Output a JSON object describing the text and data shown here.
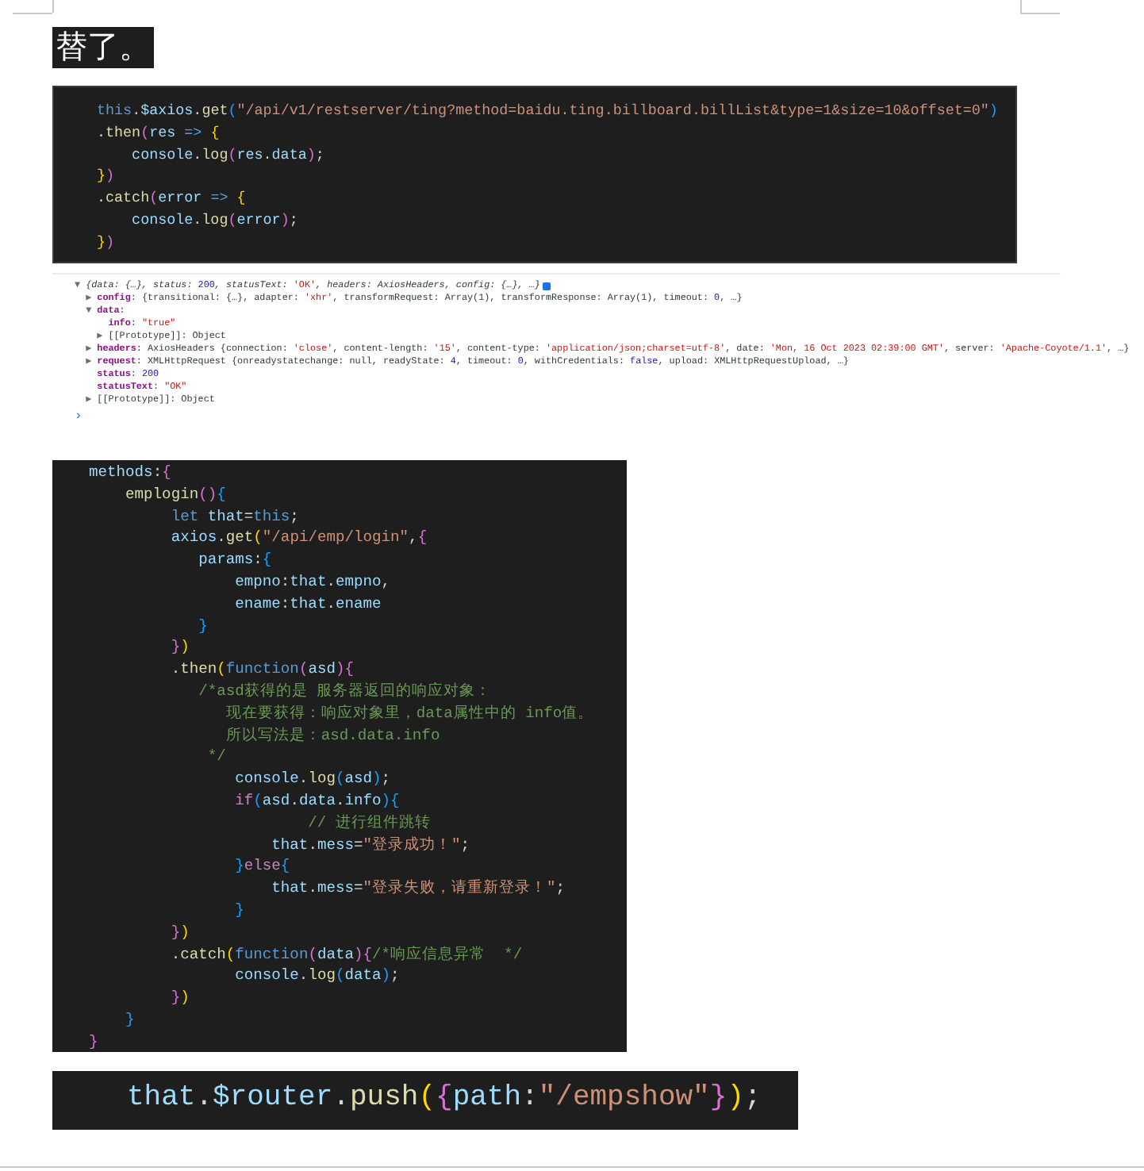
{
  "heading": "替了。",
  "code_block_1": [
    [
      {
        "text": "this",
        "kind": "kw"
      },
      {
        "text": ".",
        "kind": "p"
      },
      {
        "text": "$axios",
        "kind": "var"
      },
      {
        "text": ".",
        "kind": "p"
      },
      {
        "text": "get",
        "kind": "fn"
      },
      {
        "text": "(",
        "kind": "b3"
      },
      {
        "text": "\"/api/v1/restserver/ting?method=baidu.ting.billboard.billList&type=1&size=10&offset=0\"",
        "kind": "str"
      },
      {
        "text": ")",
        "kind": "b3"
      }
    ],
    [
      {
        "text": ".",
        "kind": "p"
      },
      {
        "text": "then",
        "kind": "fn"
      },
      {
        "text": "(",
        "kind": "b2"
      },
      {
        "text": "res",
        "kind": "var"
      },
      {
        "text": " => ",
        "kind": "kw"
      },
      {
        "text": "{",
        "kind": "b1"
      }
    ],
    [
      {
        "text": "    console",
        "kind": "var"
      },
      {
        "text": ".",
        "kind": "p"
      },
      {
        "text": "log",
        "kind": "fn"
      },
      {
        "text": "(",
        "kind": "b2"
      },
      {
        "text": "res",
        "kind": "var"
      },
      {
        "text": ".",
        "kind": "p"
      },
      {
        "text": "data",
        "kind": "var"
      },
      {
        "text": ")",
        "kind": "b2"
      },
      {
        "text": ";",
        "kind": "p"
      }
    ],
    [
      {
        "text": "}",
        "kind": "b1"
      },
      {
        "text": ")",
        "kind": "b2"
      }
    ],
    [
      {
        "text": ".",
        "kind": "p"
      },
      {
        "text": "catch",
        "kind": "fn"
      },
      {
        "text": "(",
        "kind": "b2"
      },
      {
        "text": "error",
        "kind": "var"
      },
      {
        "text": " => ",
        "kind": "kw"
      },
      {
        "text": "{",
        "kind": "b1"
      }
    ],
    [
      {
        "text": "    console",
        "kind": "var"
      },
      {
        "text": ".",
        "kind": "p"
      },
      {
        "text": "log",
        "kind": "fn"
      },
      {
        "text": "(",
        "kind": "b2"
      },
      {
        "text": "error",
        "kind": "var"
      },
      {
        "text": ")",
        "kind": "b2"
      },
      {
        "text": ";",
        "kind": "p"
      }
    ],
    [
      {
        "text": "}",
        "kind": "b1"
      },
      {
        "text": ")",
        "kind": "b2"
      }
    ]
  ],
  "console": [
    [
      {
        "text": "▼ ",
        "kind": "tri"
      },
      {
        "text": "{data: {…}, status: ",
        "kind": "it"
      },
      {
        "text": "200",
        "kind": "num"
      },
      {
        "text": ", statusText: ",
        "kind": "it"
      },
      {
        "text": "'OK'",
        "kind": "str"
      },
      {
        "text": ", headers: AxiosHeaders, config: {…}, …}",
        "kind": "it"
      }
    ],
    [
      {
        "text": "  ▶ ",
        "kind": "tri"
      },
      {
        "text": "config",
        "kind": "key"
      },
      {
        "text": ": {transitional: {…}, adapter: ",
        "kind": "p"
      },
      {
        "text": "'xhr'",
        "kind": "str"
      },
      {
        "text": ", transformRequest: Array(1), transformResponse: Array(1), timeout: ",
        "kind": "p"
      },
      {
        "text": "0",
        "kind": "num"
      },
      {
        "text": ", …}",
        "kind": "p"
      }
    ],
    [
      {
        "text": "  ▼ ",
        "kind": "tri"
      },
      {
        "text": "data",
        "kind": "key"
      },
      {
        "text": ":",
        "kind": "p"
      }
    ],
    [
      {
        "text": "      info",
        "kind": "key"
      },
      {
        "text": ": ",
        "kind": "p"
      },
      {
        "text": "\"true\"",
        "kind": "str"
      }
    ],
    [
      {
        "text": "    ▶ ",
        "kind": "tri"
      },
      {
        "text": "[[Prototype]]: Object",
        "kind": "p"
      }
    ],
    [
      {
        "text": "  ▶ ",
        "kind": "tri"
      },
      {
        "text": "headers",
        "kind": "key"
      },
      {
        "text": ": AxiosHeaders {connection: ",
        "kind": "p"
      },
      {
        "text": "'close'",
        "kind": "str"
      },
      {
        "text": ", content-length: ",
        "kind": "p"
      },
      {
        "text": "'15'",
        "kind": "str"
      },
      {
        "text": ", content-type: ",
        "kind": "p"
      },
      {
        "text": "'application/json;charset=utf-8'",
        "kind": "str"
      },
      {
        "text": ", date: ",
        "kind": "p"
      },
      {
        "text": "'Mon, 16 Oct 2023 02:39:00 GMT'",
        "kind": "str"
      },
      {
        "text": ", server: ",
        "kind": "p"
      },
      {
        "text": "'Apache-Coyote/1.1'",
        "kind": "str"
      },
      {
        "text": ", …}",
        "kind": "p"
      }
    ],
    [
      {
        "text": "  ▶ ",
        "kind": "tri"
      },
      {
        "text": "request",
        "kind": "key"
      },
      {
        "text": ": XMLHttpRequest {onreadystatechange: null, readyState: ",
        "kind": "p"
      },
      {
        "text": "4",
        "kind": "num"
      },
      {
        "text": ", timeout: ",
        "kind": "p"
      },
      {
        "text": "0",
        "kind": "num"
      },
      {
        "text": ", withCredentials: ",
        "kind": "p"
      },
      {
        "text": "false",
        "kind": "num"
      },
      {
        "text": ", upload: XMLHttpRequestUpload, …}",
        "kind": "p"
      }
    ],
    [
      {
        "text": "    status",
        "kind": "key"
      },
      {
        "text": ": ",
        "kind": "p"
      },
      {
        "text": "200",
        "kind": "num"
      }
    ],
    [
      {
        "text": "    statusText",
        "kind": "key"
      },
      {
        "text": ": ",
        "kind": "p"
      },
      {
        "text": "\"OK\"",
        "kind": "str"
      }
    ],
    [
      {
        "text": "  ▶ ",
        "kind": "tri"
      },
      {
        "text": "[[Prototype]]: Object",
        "kind": "p"
      }
    ]
  ],
  "console_prompt": "›",
  "code_block_2": [
    [
      {
        "text": "methods",
        "kind": "var"
      },
      {
        "text": ":",
        "kind": "p"
      },
      {
        "text": "{",
        "kind": "b2"
      }
    ],
    [
      {
        "text": "    emplogin",
        "kind": "fn"
      },
      {
        "text": "()",
        "kind": "b2"
      },
      {
        "text": "{",
        "kind": "b3"
      }
    ],
    [
      {
        "text": "         let ",
        "kind": "kw"
      },
      {
        "text": "that",
        "kind": "var"
      },
      {
        "text": "=",
        "kind": "p"
      },
      {
        "text": "this",
        "kind": "kw"
      },
      {
        "text": ";",
        "kind": "p"
      }
    ],
    [
      {
        "text": "         axios",
        "kind": "var"
      },
      {
        "text": ".",
        "kind": "p"
      },
      {
        "text": "get",
        "kind": "fn"
      },
      {
        "text": "(",
        "kind": "b1"
      },
      {
        "text": "\"/api/emp/login\"",
        "kind": "str"
      },
      {
        "text": ",",
        "kind": "p"
      },
      {
        "text": "{",
        "kind": "b2"
      }
    ],
    [
      {
        "text": "            params",
        "kind": "var"
      },
      {
        "text": ":",
        "kind": "p"
      },
      {
        "text": "{",
        "kind": "b3"
      }
    ],
    [
      {
        "text": "                empno",
        "kind": "var"
      },
      {
        "text": ":",
        "kind": "p"
      },
      {
        "text": "that",
        "kind": "var"
      },
      {
        "text": ".",
        "kind": "p"
      },
      {
        "text": "empno",
        "kind": "var"
      },
      {
        "text": ",",
        "kind": "p"
      }
    ],
    [
      {
        "text": "                ename",
        "kind": "var"
      },
      {
        "text": ":",
        "kind": "p"
      },
      {
        "text": "that",
        "kind": "var"
      },
      {
        "text": ".",
        "kind": "p"
      },
      {
        "text": "ename",
        "kind": "var"
      }
    ],
    [
      {
        "text": "            }",
        "kind": "b3"
      }
    ],
    [
      {
        "text": "         }",
        "kind": "b2"
      },
      {
        "text": ")",
        "kind": "b1"
      }
    ],
    [
      {
        "text": "         .",
        "kind": "p"
      },
      {
        "text": "then",
        "kind": "fn"
      },
      {
        "text": "(",
        "kind": "b1"
      },
      {
        "text": "function",
        "kind": "kw"
      },
      {
        "text": "(",
        "kind": "b2"
      },
      {
        "text": "asd",
        "kind": "var"
      },
      {
        "text": ")",
        "kind": "b2"
      },
      {
        "text": "{",
        "kind": "b2"
      }
    ],
    [
      {
        "text": "            /*asd获得的是 服务器返回的响应对象：",
        "kind": "cm"
      }
    ],
    [
      {
        "text": "               现在要获得：响应对象里，data属性中的 info值。",
        "kind": "cm"
      }
    ],
    [
      {
        "text": "               所以写法是：asd.data.info",
        "kind": "cm"
      }
    ],
    [
      {
        "text": "             */",
        "kind": "cm"
      }
    ],
    [
      {
        "text": "                console",
        "kind": "var"
      },
      {
        "text": ".",
        "kind": "p"
      },
      {
        "text": "log",
        "kind": "fn"
      },
      {
        "text": "(",
        "kind": "b3"
      },
      {
        "text": "asd",
        "kind": "var"
      },
      {
        "text": ")",
        "kind": "b3"
      },
      {
        "text": ";",
        "kind": "p"
      }
    ],
    [
      {
        "text": "                if",
        "kind": "ctrl"
      },
      {
        "text": "(",
        "kind": "b3"
      },
      {
        "text": "asd",
        "kind": "var"
      },
      {
        "text": ".",
        "kind": "p"
      },
      {
        "text": "data",
        "kind": "var"
      },
      {
        "text": ".",
        "kind": "p"
      },
      {
        "text": "info",
        "kind": "var"
      },
      {
        "text": ")",
        "kind": "b3"
      },
      {
        "text": "{",
        "kind": "b3"
      }
    ],
    [
      {
        "text": "                        // 进行组件跳转",
        "kind": "cm"
      }
    ],
    [
      {
        "text": "                    that",
        "kind": "var"
      },
      {
        "text": ".",
        "kind": "p"
      },
      {
        "text": "mess",
        "kind": "var"
      },
      {
        "text": "=",
        "kind": "p"
      },
      {
        "text": "\"登录成功！\"",
        "kind": "str"
      },
      {
        "text": ";",
        "kind": "p"
      }
    ],
    [
      {
        "text": "                }",
        "kind": "b3"
      },
      {
        "text": "else",
        "kind": "ctrl"
      },
      {
        "text": "{",
        "kind": "b3"
      }
    ],
    [
      {
        "text": "                    that",
        "kind": "var"
      },
      {
        "text": ".",
        "kind": "p"
      },
      {
        "text": "mess",
        "kind": "var"
      },
      {
        "text": "=",
        "kind": "p"
      },
      {
        "text": "\"登录失败，请重新登录！\"",
        "kind": "str"
      },
      {
        "text": ";",
        "kind": "p"
      }
    ],
    [
      {
        "text": "                }",
        "kind": "b3"
      }
    ],
    [
      {
        "text": "         }",
        "kind": "b2"
      },
      {
        "text": ")",
        "kind": "b1"
      }
    ],
    [
      {
        "text": "         .",
        "kind": "p"
      },
      {
        "text": "catch",
        "kind": "fn"
      },
      {
        "text": "(",
        "kind": "b1"
      },
      {
        "text": "function",
        "kind": "kw"
      },
      {
        "text": "(",
        "kind": "b2"
      },
      {
        "text": "data",
        "kind": "var"
      },
      {
        "text": ")",
        "kind": "b2"
      },
      {
        "text": "{",
        "kind": "b2"
      },
      {
        "text": "/*响应信息异常  */",
        "kind": "cm"
      }
    ],
    [
      {
        "text": "                console",
        "kind": "var"
      },
      {
        "text": ".",
        "kind": "p"
      },
      {
        "text": "log",
        "kind": "fn"
      },
      {
        "text": "(",
        "kind": "b3"
      },
      {
        "text": "data",
        "kind": "var"
      },
      {
        "text": ")",
        "kind": "b3"
      },
      {
        "text": ";",
        "kind": "p"
      }
    ],
    [
      {
        "text": "         }",
        "kind": "b2"
      },
      {
        "text": ")",
        "kind": "b1"
      }
    ],
    [
      {
        "text": "    }",
        "kind": "b3"
      }
    ],
    [
      {
        "text": "}",
        "kind": "b2"
      }
    ]
  ],
  "code_block_3": [
    [
      {
        "text": "that",
        "kind": "var"
      },
      {
        "text": ".",
        "kind": "p"
      },
      {
        "text": "$router",
        "kind": "var"
      },
      {
        "text": ".",
        "kind": "p"
      },
      {
        "text": "push",
        "kind": "fn"
      },
      {
        "text": "(",
        "kind": "b1"
      },
      {
        "text": "{",
        "kind": "b2"
      },
      {
        "text": "path",
        "kind": "var"
      },
      {
        "text": ":",
        "kind": "p"
      },
      {
        "text": "\"/empshow\"",
        "kind": "str"
      },
      {
        "text": "}",
        "kind": "b2"
      },
      {
        "text": ")",
        "kind": "b1"
      },
      {
        "text": ";",
        "kind": "p"
      }
    ]
  ]
}
